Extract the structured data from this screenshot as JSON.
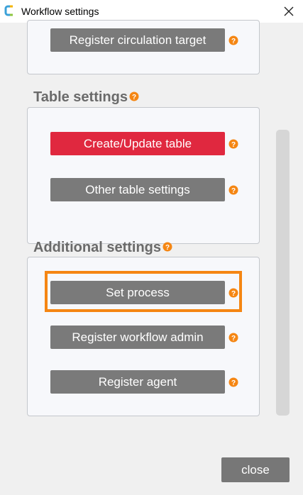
{
  "window": {
    "title": "Workflow settings"
  },
  "sections": {
    "top": {
      "buttons": [
        {
          "label": "Register circulation target"
        }
      ]
    },
    "table_settings": {
      "heading": "Table settings",
      "buttons": [
        {
          "label": "Create/Update table"
        },
        {
          "label": "Other table settings"
        }
      ]
    },
    "additional_settings": {
      "heading": "Additional settings",
      "buttons": [
        {
          "label": "Set process"
        },
        {
          "label": "Register workflow admin"
        },
        {
          "label": "Register agent"
        }
      ]
    }
  },
  "footer": {
    "close_label": "close"
  },
  "colors": {
    "primary_button": "#7a7a7a",
    "active_button": "#e0283f",
    "help_icon": "#f58613",
    "highlight": "#f58613"
  },
  "icons": {
    "app": "app-logo-icon",
    "close": "close-icon",
    "help": "help-icon"
  }
}
